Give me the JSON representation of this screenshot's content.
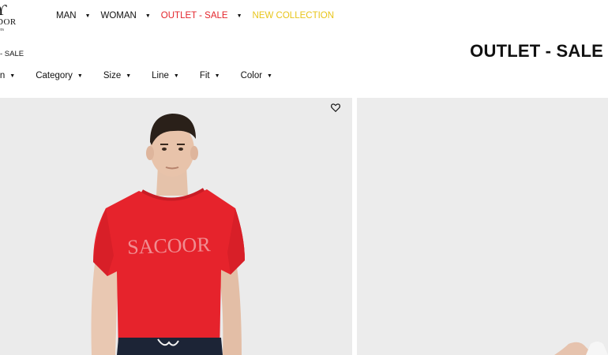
{
  "header": {
    "logo": {
      "word": "DOR",
      "sub": "ers"
    },
    "nav": [
      {
        "label": "MAN"
      },
      {
        "label": "WOMAN"
      },
      {
        "label": "OUTLET - SALE"
      },
      {
        "label": "NEW COLLECTION"
      }
    ]
  },
  "breadcrumb": "- SALE",
  "page_title": "OUTLET - SALE",
  "filters": [
    {
      "label": "ction"
    },
    {
      "label": "Category"
    },
    {
      "label": "Size"
    },
    {
      "label": "Line"
    },
    {
      "label": "Fit"
    },
    {
      "label": "Color"
    }
  ],
  "products": [
    {
      "shirt_text": "SACOOR"
    }
  ],
  "colors": {
    "outlet": "#e3242b",
    "new_collection": "#e8c51a",
    "product_bg": "#ebebeb",
    "shirt": "#e6232c"
  },
  "icons": {
    "nav_caret": "caret-down-icon",
    "wishlist": "heart-icon"
  }
}
